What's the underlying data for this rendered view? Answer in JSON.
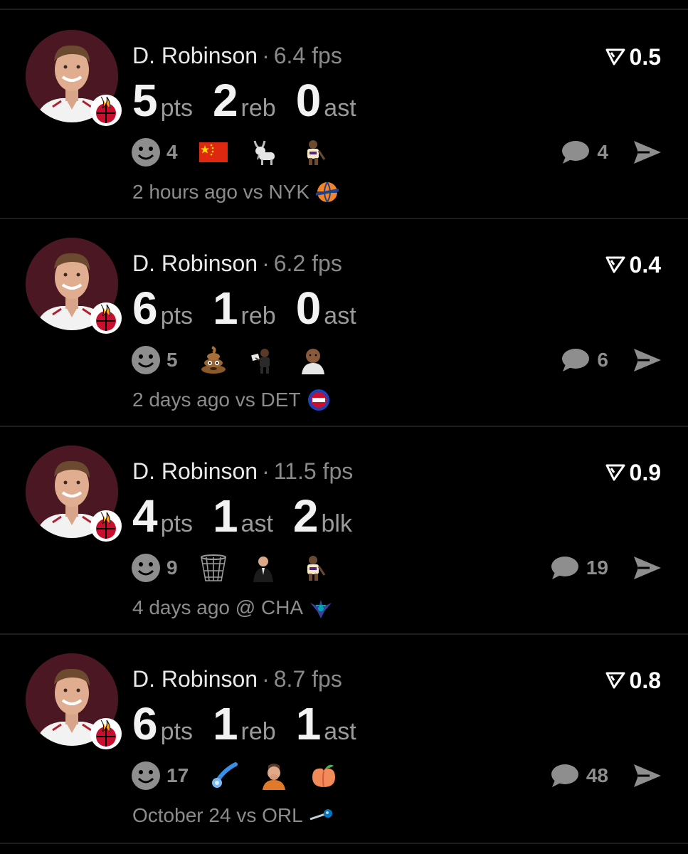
{
  "colors": {
    "background": "#000000",
    "avatar_bg": "#4a1722",
    "muted_text": "#8c8c8c",
    "divider": "#1e1e1e"
  },
  "posts": [
    {
      "player": "D. Robinson",
      "separator": "·",
      "fps": "6.4 fps",
      "rating": "0.5",
      "stats": [
        {
          "value": "5",
          "label": "pts"
        },
        {
          "value": "2",
          "label": "reb"
        },
        {
          "value": "0",
          "label": "ast"
        }
      ],
      "reaction_count": "4",
      "emojis": [
        "china-flag-icon",
        "goat-icon",
        "player-sticker-icon"
      ],
      "comment_count": "4",
      "time": "2 hours ago",
      "matchup": "vs NYK",
      "opponent_logo": "knicks-logo-icon"
    },
    {
      "player": "D. Robinson",
      "separator": "·",
      "fps": "6.2 fps",
      "rating": "0.4",
      "stats": [
        {
          "value": "6",
          "label": "pts"
        },
        {
          "value": "1",
          "label": "reb"
        },
        {
          "value": "0",
          "label": "ast"
        }
      ],
      "reaction_count": "5",
      "emojis": [
        "poop-icon",
        "reading-person-icon",
        "bald-man-icon"
      ],
      "comment_count": "6",
      "time": "2 days ago",
      "matchup": "vs DET",
      "opponent_logo": "pistons-logo-icon"
    },
    {
      "player": "D. Robinson",
      "separator": "·",
      "fps": "11.5 fps",
      "rating": "0.9",
      "stats": [
        {
          "value": "4",
          "label": "pts"
        },
        {
          "value": "1",
          "label": "ast"
        },
        {
          "value": "2",
          "label": "blk"
        }
      ],
      "reaction_count": "9",
      "emojis": [
        "basketball-net-icon",
        "coach-icon",
        "player-sticker-icon"
      ],
      "comment_count": "19",
      "time": "4 days ago",
      "matchup": "@ CHA",
      "opponent_logo": "hornets-logo-icon"
    },
    {
      "player": "D. Robinson",
      "separator": "·",
      "fps": "8.7 fps",
      "rating": "0.8",
      "stats": [
        {
          "value": "6",
          "label": "pts"
        },
        {
          "value": "1",
          "label": "reb"
        },
        {
          "value": "1",
          "label": "ast"
        }
      ],
      "reaction_count": "17",
      "emojis": [
        "comet-icon",
        "face-palm-person-icon",
        "peach-icon"
      ],
      "comment_count": "48",
      "time": "October 24",
      "matchup": "vs ORL",
      "opponent_logo": "magic-logo-icon"
    }
  ]
}
